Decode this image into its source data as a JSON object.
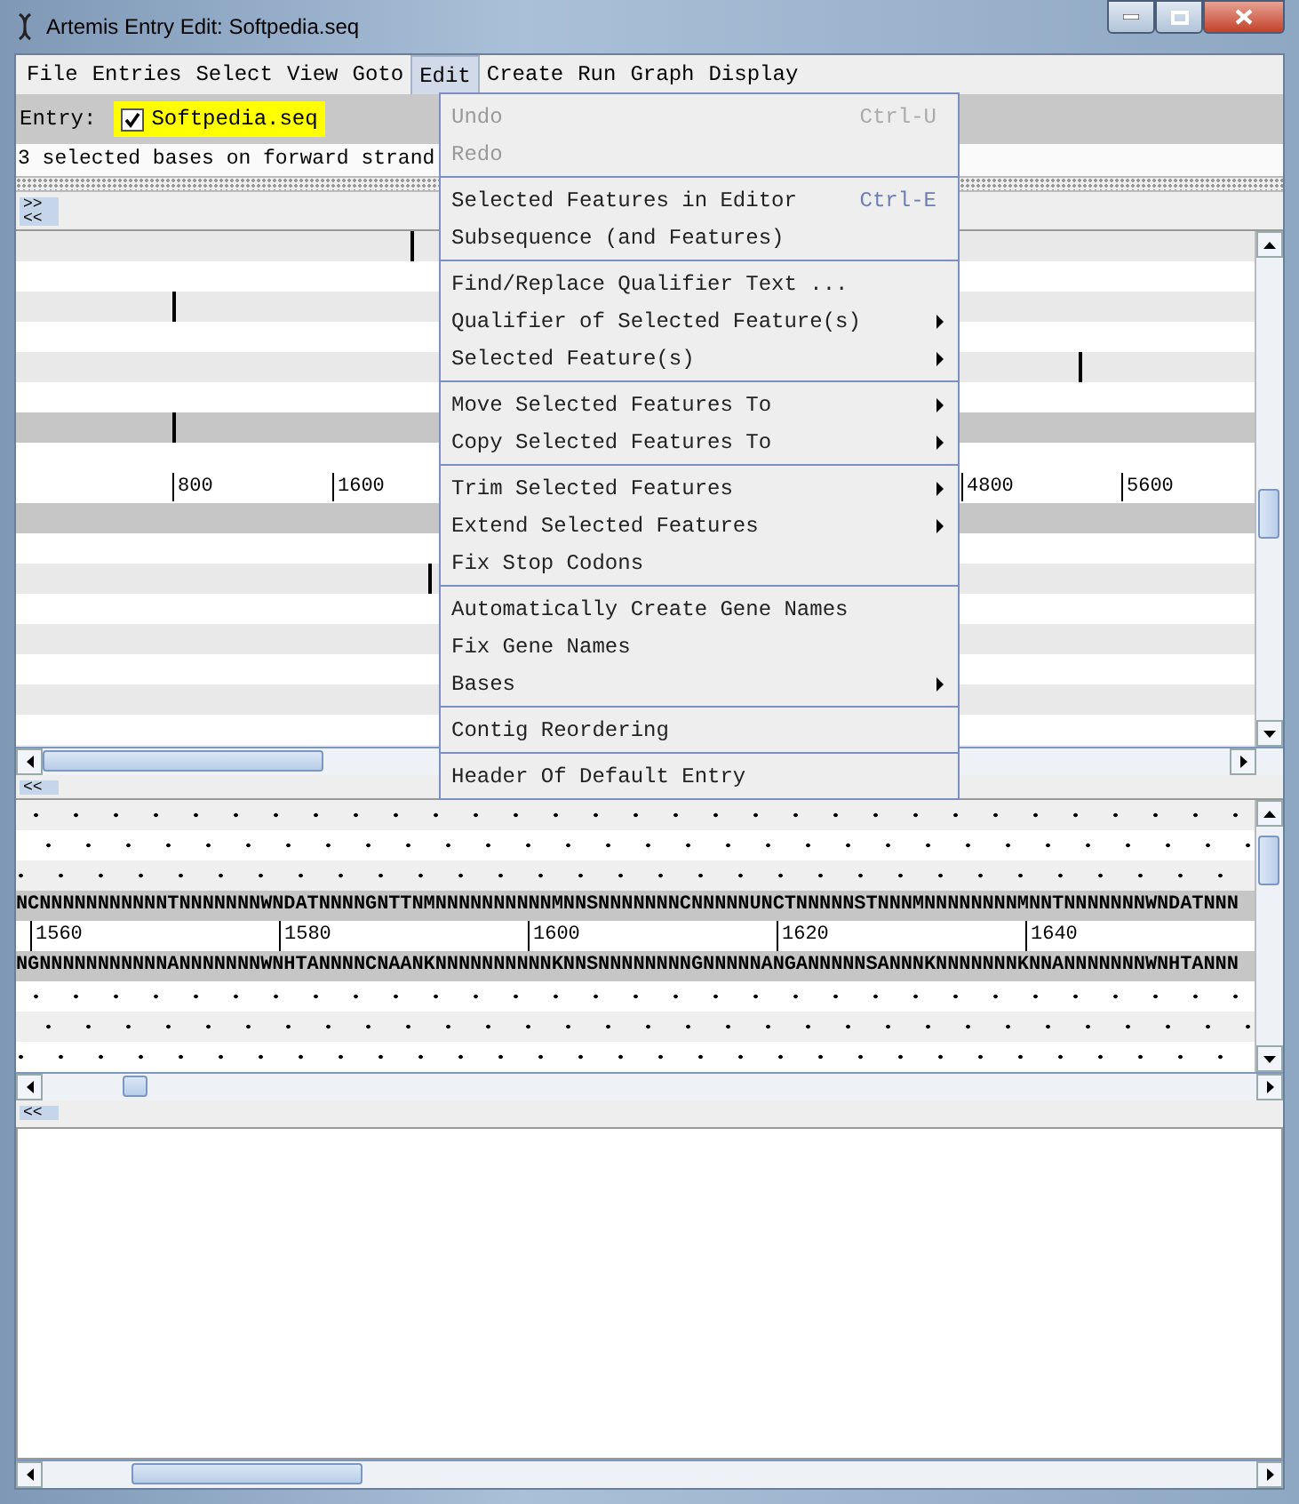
{
  "window": {
    "title": "Artemis Entry Edit: Softpedia.seq"
  },
  "menu_bar": [
    {
      "label": "File",
      "selected": false
    },
    {
      "label": "Entries",
      "selected": false
    },
    {
      "label": "Select",
      "selected": false
    },
    {
      "label": "View",
      "selected": false
    },
    {
      "label": "Goto",
      "selected": false
    },
    {
      "label": "Edit",
      "selected": true
    },
    {
      "label": "Create",
      "selected": false
    },
    {
      "label": "Run",
      "selected": false
    },
    {
      "label": "Graph",
      "selected": false
    },
    {
      "label": "Display",
      "selected": false
    }
  ],
  "entry_bar": {
    "label": "Entry:",
    "entries": [
      {
        "name": "Softpedia.seq",
        "checked": true
      }
    ]
  },
  "status": "3 selected bases on forward strand",
  "overview": {
    "nav_buttons": [
      ">>",
      "<<"
    ],
    "ruler": {
      "left_ticks": [
        "800",
        "1600"
      ],
      "right_ticks": [
        "4800",
        "5600"
      ]
    }
  },
  "overview_collapse": "<<",
  "bases": {
    "forward": "NCNNNNNNNNNNNTNNNNNNNWNDATNNNNGNTTNMNNNNNNNNNNMNNSNNNNNNNCNNNNNUNCTNNNNNSTNNNMNNNNNNNNMNNTNNNNNNNWNDATNNN",
    "ruler": [
      "1560",
      "1580",
      "1600",
      "1620",
      "1640"
    ],
    "reverse": "NGNNNNNNNNNNNANNNNNNNWNHTANNNNCNAANKNNNNNNNNNNKNNSNNNNNNNNGNNNNNANGANNNNNSANNNKNNNNNNNKNNANNNNNNNWNHTANNN"
  },
  "bases_collapse": "<<",
  "edit_menu": [
    [
      {
        "label": "Undo",
        "shortcut": "Ctrl-U",
        "disabled": true,
        "submenu": false
      },
      {
        "label": "Redo",
        "disabled": true,
        "submenu": false
      }
    ],
    [
      {
        "label": "Selected Features in Editor",
        "shortcut": "Ctrl-E",
        "disabled": false,
        "submenu": false
      },
      {
        "label": "Subsequence (and Features)",
        "disabled": false,
        "submenu": false
      }
    ],
    [
      {
        "label": "Find/Replace Qualifier Text ...",
        "disabled": false,
        "submenu": false
      },
      {
        "label": "Qualifier of Selected Feature(s)",
        "disabled": false,
        "submenu": true
      },
      {
        "label": "Selected Feature(s)",
        "disabled": false,
        "submenu": true
      }
    ],
    [
      {
        "label": "Move Selected Features To",
        "disabled": false,
        "submenu": true
      },
      {
        "label": "Copy Selected Features To",
        "disabled": false,
        "submenu": true
      }
    ],
    [
      {
        "label": "Trim Selected Features",
        "disabled": false,
        "submenu": true
      },
      {
        "label": "Extend Selected Features",
        "disabled": false,
        "submenu": true
      },
      {
        "label": "Fix Stop Codons",
        "disabled": false,
        "submenu": false
      }
    ],
    [
      {
        "label": "Automatically Create Gene Names",
        "disabled": false,
        "submenu": false
      },
      {
        "label": "Fix Gene Names",
        "disabled": false,
        "submenu": false
      },
      {
        "label": "Bases",
        "disabled": false,
        "submenu": true
      }
    ],
    [
      {
        "label": "Contig Reordering",
        "disabled": false,
        "submenu": false
      }
    ],
    [
      {
        "label": "Header Of Default Entry",
        "disabled": false,
        "submenu": false
      }
    ]
  ]
}
